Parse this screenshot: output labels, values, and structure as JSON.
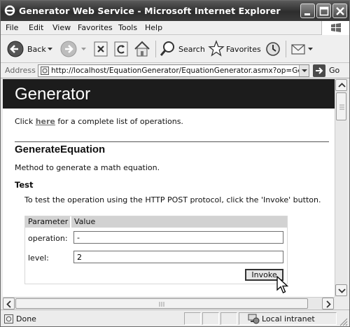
{
  "window": {
    "title": "Generator Web Service - Microsoft Internet Explorer"
  },
  "menu": [
    "File",
    "Edit",
    "View",
    "Favorites",
    "Tools",
    "Help"
  ],
  "toolbar": {
    "back_label": "Back",
    "search_label": "Search",
    "favorites_label": "Favorites"
  },
  "address": {
    "label": "Address",
    "url": "http://localhost/EquationGenerator/EquationGenerator.asmx?op=GenerateEq",
    "go_label": "Go"
  },
  "page": {
    "banner_title": "Generator",
    "intro_before": "Click ",
    "intro_link": "here",
    "intro_after": " for a complete list of operations.",
    "operation_title": "GenerateEquation",
    "operation_desc": "Method to generate a math equation.",
    "test_heading": "Test",
    "test_desc": "To test the operation using the HTTP POST protocol, click the 'Invoke' button.",
    "param_header": "Parameter",
    "value_header": "Value",
    "params": [
      {
        "label": "operation:",
        "value": "-"
      },
      {
        "label": "level:",
        "value": "2"
      }
    ],
    "invoke_label": "Invoke"
  },
  "status": {
    "text": "Done",
    "zone": "Local intranet"
  }
}
